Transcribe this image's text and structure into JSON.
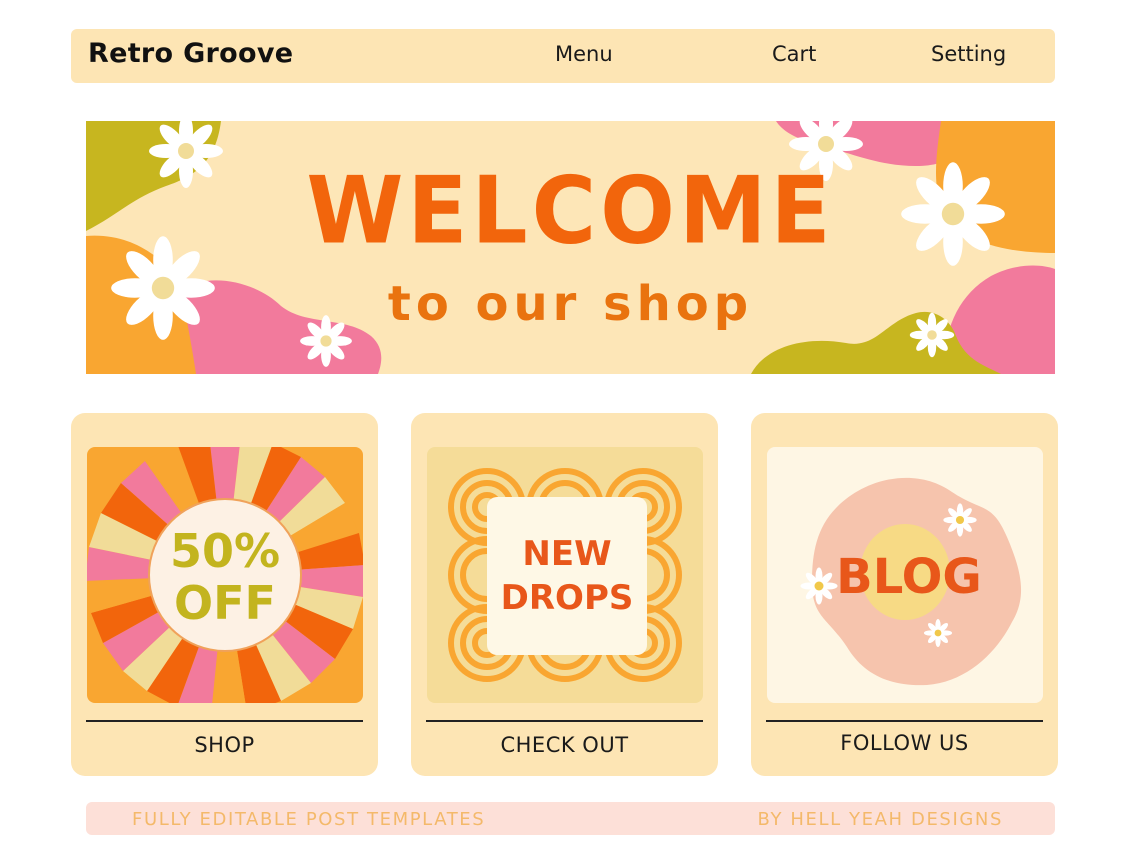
{
  "navbar": {
    "brand": "Retro Groove",
    "links": [
      "Menu",
      "Cart",
      "Setting"
    ]
  },
  "banner": {
    "title": "WELCOME",
    "subtitle": "to our shop"
  },
  "cards": [
    {
      "image_text": [
        "50%",
        "OFF"
      ],
      "label": "SHOP"
    },
    {
      "image_text": [
        "NEW",
        "DROPS"
      ],
      "label": "CHECK OUT"
    },
    {
      "image_text": [
        "BLOG"
      ],
      "label": "FOLLOW US"
    }
  ],
  "footer": {
    "left": "FULLY EDITABLE POST TEMPLATES",
    "right": "BY HELL YEAH DESIGNS"
  },
  "colors": {
    "panel": "#fde5b4",
    "orange": "#f2650c",
    "olive": "#c3b41e",
    "pink": "#f27a9c",
    "footer_bg": "#fde0d8",
    "footer_text": "#f4b96a"
  }
}
